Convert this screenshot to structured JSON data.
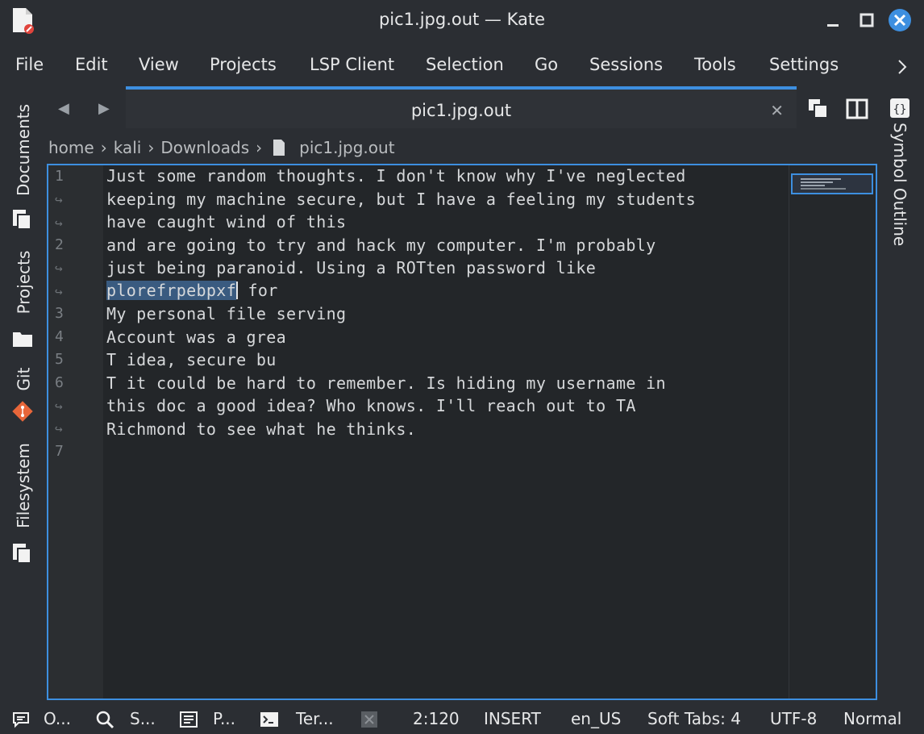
{
  "window": {
    "title": "pic1.jpg.out — Kate"
  },
  "menu": [
    "File",
    "Edit",
    "View",
    "Projects",
    "LSP Client",
    "Selection",
    "Go",
    "Sessions",
    "Tools",
    "Settings"
  ],
  "left_sidebar": {
    "documents": "Documents",
    "projects": "Projects",
    "git": "Git",
    "filesystem": "Filesystem"
  },
  "right_sidebar": {
    "symbol_outline": "Symbol Outline"
  },
  "tab": {
    "label": "pic1.jpg.out"
  },
  "breadcrumb": [
    "home",
    "kali",
    "Downloads",
    "pic1.jpg.out"
  ],
  "editor": {
    "gutter": [
      "1",
      "↪",
      "↪",
      "2",
      "↪",
      "↪",
      "3",
      "4",
      "5",
      "6",
      "↪",
      "↪",
      "7"
    ],
    "lines": [
      "Just some random thoughts. I don't know why I've neglected",
      "keeping my machine secure, but I have a feeling my students",
      "have caught wind of this",
      "and are going to try and hack my computer. I'm probably",
      "just being paranoid. Using a ROTten password like",
      "",
      "My personal file serving",
      "Account was a grea",
      "T idea, secure bu",
      "T it could be hard to remember. Is hiding my username in",
      "this doc a good idea? Who knows. I'll reach out to TA",
      "Richmond to see what he thinks.",
      ""
    ],
    "selected_text": "plorefrpebpxf",
    "after_selection": " for"
  },
  "statusbar": {
    "output": "O...",
    "search": "S...",
    "projects": "P...",
    "terminal": "Ter...",
    "cursor": "2:120",
    "mode": "INSERT",
    "language": "en_US",
    "indent": "Soft Tabs: 4",
    "encoding": "UTF-8",
    "input_mode": "Normal"
  },
  "colors": {
    "accent": "#3d8fe0",
    "background": "#2b2e33",
    "editor_background": "#232629",
    "selection": "#3a5b80"
  }
}
